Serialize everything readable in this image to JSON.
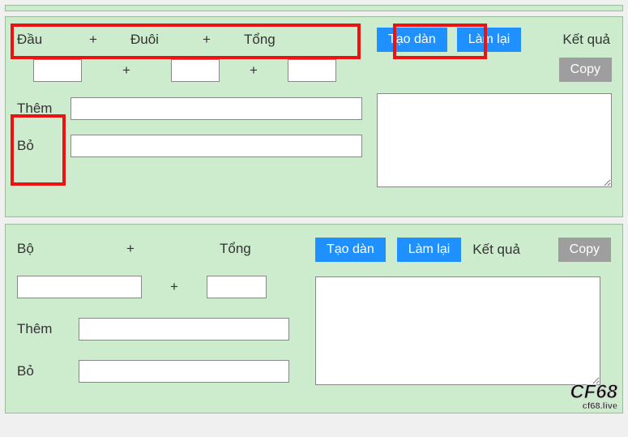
{
  "panel1": {
    "header": {
      "dau": "Đầu",
      "duoi": "Đuôi",
      "tong": "Tổng"
    },
    "plus": "+",
    "inputs": {
      "dau": "",
      "duoi": "",
      "tong": ""
    },
    "them_label": "Thêm",
    "them_value": "",
    "bo_label": "Bỏ",
    "bo_value": "",
    "btn_create": "Tạo dàn",
    "btn_reset": "Làm lại",
    "result_label": "Kết quả",
    "btn_copy": "Copy",
    "result_text": ""
  },
  "panel2": {
    "header": {
      "bo": "Bộ",
      "tong": "Tổng"
    },
    "plus": "+",
    "inputs": {
      "bo": "",
      "tong": ""
    },
    "them_label": "Thêm",
    "them_value": "",
    "bo_label": "Bỏ",
    "bo_value": "",
    "btn_create": "Tạo dàn",
    "btn_reset": "Làm lại",
    "result_label": "Kết quả",
    "btn_copy": "Copy",
    "result_text": ""
  },
  "watermark": {
    "line1": "CF68",
    "line2": "cf68.live"
  }
}
